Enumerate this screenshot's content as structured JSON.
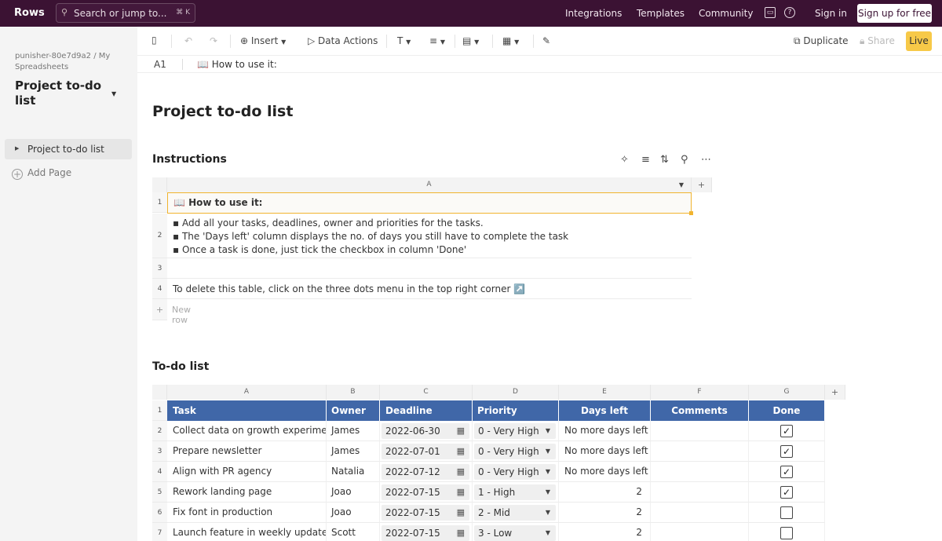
{
  "topbar": {
    "logo": "Rows",
    "search_placeholder": "Search or jump to...",
    "search_shortcut": "⌘ K",
    "nav": [
      "Integrations",
      "Templates",
      "Community"
    ],
    "signin": "Sign in",
    "signup": "Sign up for free"
  },
  "sidebar": {
    "breadcrumb": "punisher-80e7d9a2 / My Spreadsheets",
    "doc_title": "Project to-do list",
    "pages": [
      "Project to-do list"
    ],
    "add_page": "Add Page"
  },
  "toolbar": {
    "insert": "Insert",
    "data_actions": "Data Actions",
    "duplicate": "Duplicate",
    "share": "Share",
    "live": "Live"
  },
  "formula_bar": {
    "cell_ref": "A1",
    "value": "📖 How to use it:"
  },
  "page_title": "Project to-do list",
  "instructions": {
    "heading": "Instructions",
    "col_header": "A",
    "rows": [
      {
        "num": "1",
        "text": "📖  How to use it:"
      },
      {
        "num": "2",
        "lines": [
          "▪ Add all your tasks, deadlines, owner and priorities for the tasks.",
          "▪ The 'Days left' column displays the no. of days you still have to complete the task",
          "▪ Once a task is done, just tick the checkbox in column 'Done'"
        ]
      },
      {
        "num": "3",
        "text": ""
      },
      {
        "num": "4",
        "text": "To delete this table, click on the three dots menu in the top right corner ↗️"
      }
    ],
    "new_row": "New row"
  },
  "todo": {
    "heading": "To-do list",
    "col_letters": [
      "A",
      "B",
      "C",
      "D",
      "E",
      "F",
      "G"
    ],
    "headers": [
      "Task",
      "Owner",
      "Deadline",
      "Priority",
      "Days left",
      "Comments",
      "Done"
    ],
    "rows": [
      {
        "num": "2",
        "task": "Collect data on growth experiment",
        "owner": "James",
        "deadline": "2022-06-30",
        "priority": "0 - Very High",
        "days_left": "No more days left",
        "comments": "",
        "done": true
      },
      {
        "num": "3",
        "task": "Prepare newsletter",
        "owner": "James",
        "deadline": "2022-07-01",
        "priority": "0 - Very High",
        "days_left": "No more days left",
        "comments": "",
        "done": true
      },
      {
        "num": "4",
        "task": "Align with PR agency",
        "owner": "Natalia",
        "deadline": "2022-07-12",
        "priority": "0 - Very High",
        "days_left": "No more days left",
        "comments": "",
        "done": true
      },
      {
        "num": "5",
        "task": "Rework landing page",
        "owner": "Joao",
        "deadline": "2022-07-15",
        "priority": "1 - High",
        "days_left": "2",
        "comments": "",
        "done": true
      },
      {
        "num": "6",
        "task": "Fix font in production",
        "owner": "Joao",
        "deadline": "2022-07-15",
        "priority": "2 - Mid",
        "days_left": "2",
        "comments": "",
        "done": false
      },
      {
        "num": "7",
        "task": "Launch feature in weekly update",
        "owner": "Scott",
        "deadline": "2022-07-15",
        "priority": "3 - Low",
        "days_left": "2",
        "comments": "",
        "done": false
      }
    ]
  },
  "colors": {
    "topbar_bg": "#3b1233",
    "header_blue": "#4067a8",
    "selection": "#f1b42f",
    "live_badge": "#f7c948"
  }
}
